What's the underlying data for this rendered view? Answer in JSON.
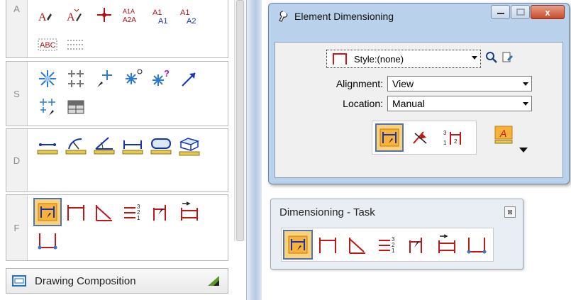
{
  "left_palette": {
    "groups": [
      {
        "letter": "A",
        "tools": [
          "place-text-icon",
          "edit-text-icon",
          "place-note-icon",
          "text-transform-icon",
          "increment-text-icon",
          "copy-increment-text-icon",
          "spell-check-icon",
          "fill-in-fields-icon"
        ]
      },
      {
        "letter": "S",
        "tools": [
          "place-cell-icon",
          "select-cell-icon",
          "replace-cell-icon",
          "define-cell-origin-icon",
          "identify-cell-icon",
          "place-leader-icon",
          "pattern-area-icon",
          "place-table-icon"
        ]
      },
      {
        "letter": "D",
        "tools": [
          "measure-distance-icon",
          "measure-radius-icon",
          "measure-angle-icon",
          "measure-length-icon",
          "measure-area-icon",
          "measure-volume-icon"
        ]
      },
      {
        "letter": "F",
        "tools": [
          "dimension-element-icon",
          "dimension-linear-icon",
          "dimension-angle-icon",
          "dimension-ordinate-icon",
          "label-coordinates-icon",
          "change-dimension-icon",
          "dimension-size-icon"
        ]
      }
    ],
    "drawing_composition_label": "Drawing Composition"
  },
  "element_dimensioning": {
    "title": "Element Dimensioning",
    "style_value": "Style:(none)",
    "alignment_label": "Alignment:",
    "alignment_value": "View",
    "location_label": "Location:",
    "location_value": "Manual",
    "close_symbol": "x"
  },
  "task": {
    "title": "Dimensioning - Task",
    "close_symbol": "⊠",
    "tools": [
      "dimension-element-icon",
      "dimension-linear-icon",
      "dimension-angle-icon",
      "dimension-ordinate-icon",
      "label-coordinates-icon",
      "change-dimension-icon",
      "dimension-size-icon"
    ]
  }
}
